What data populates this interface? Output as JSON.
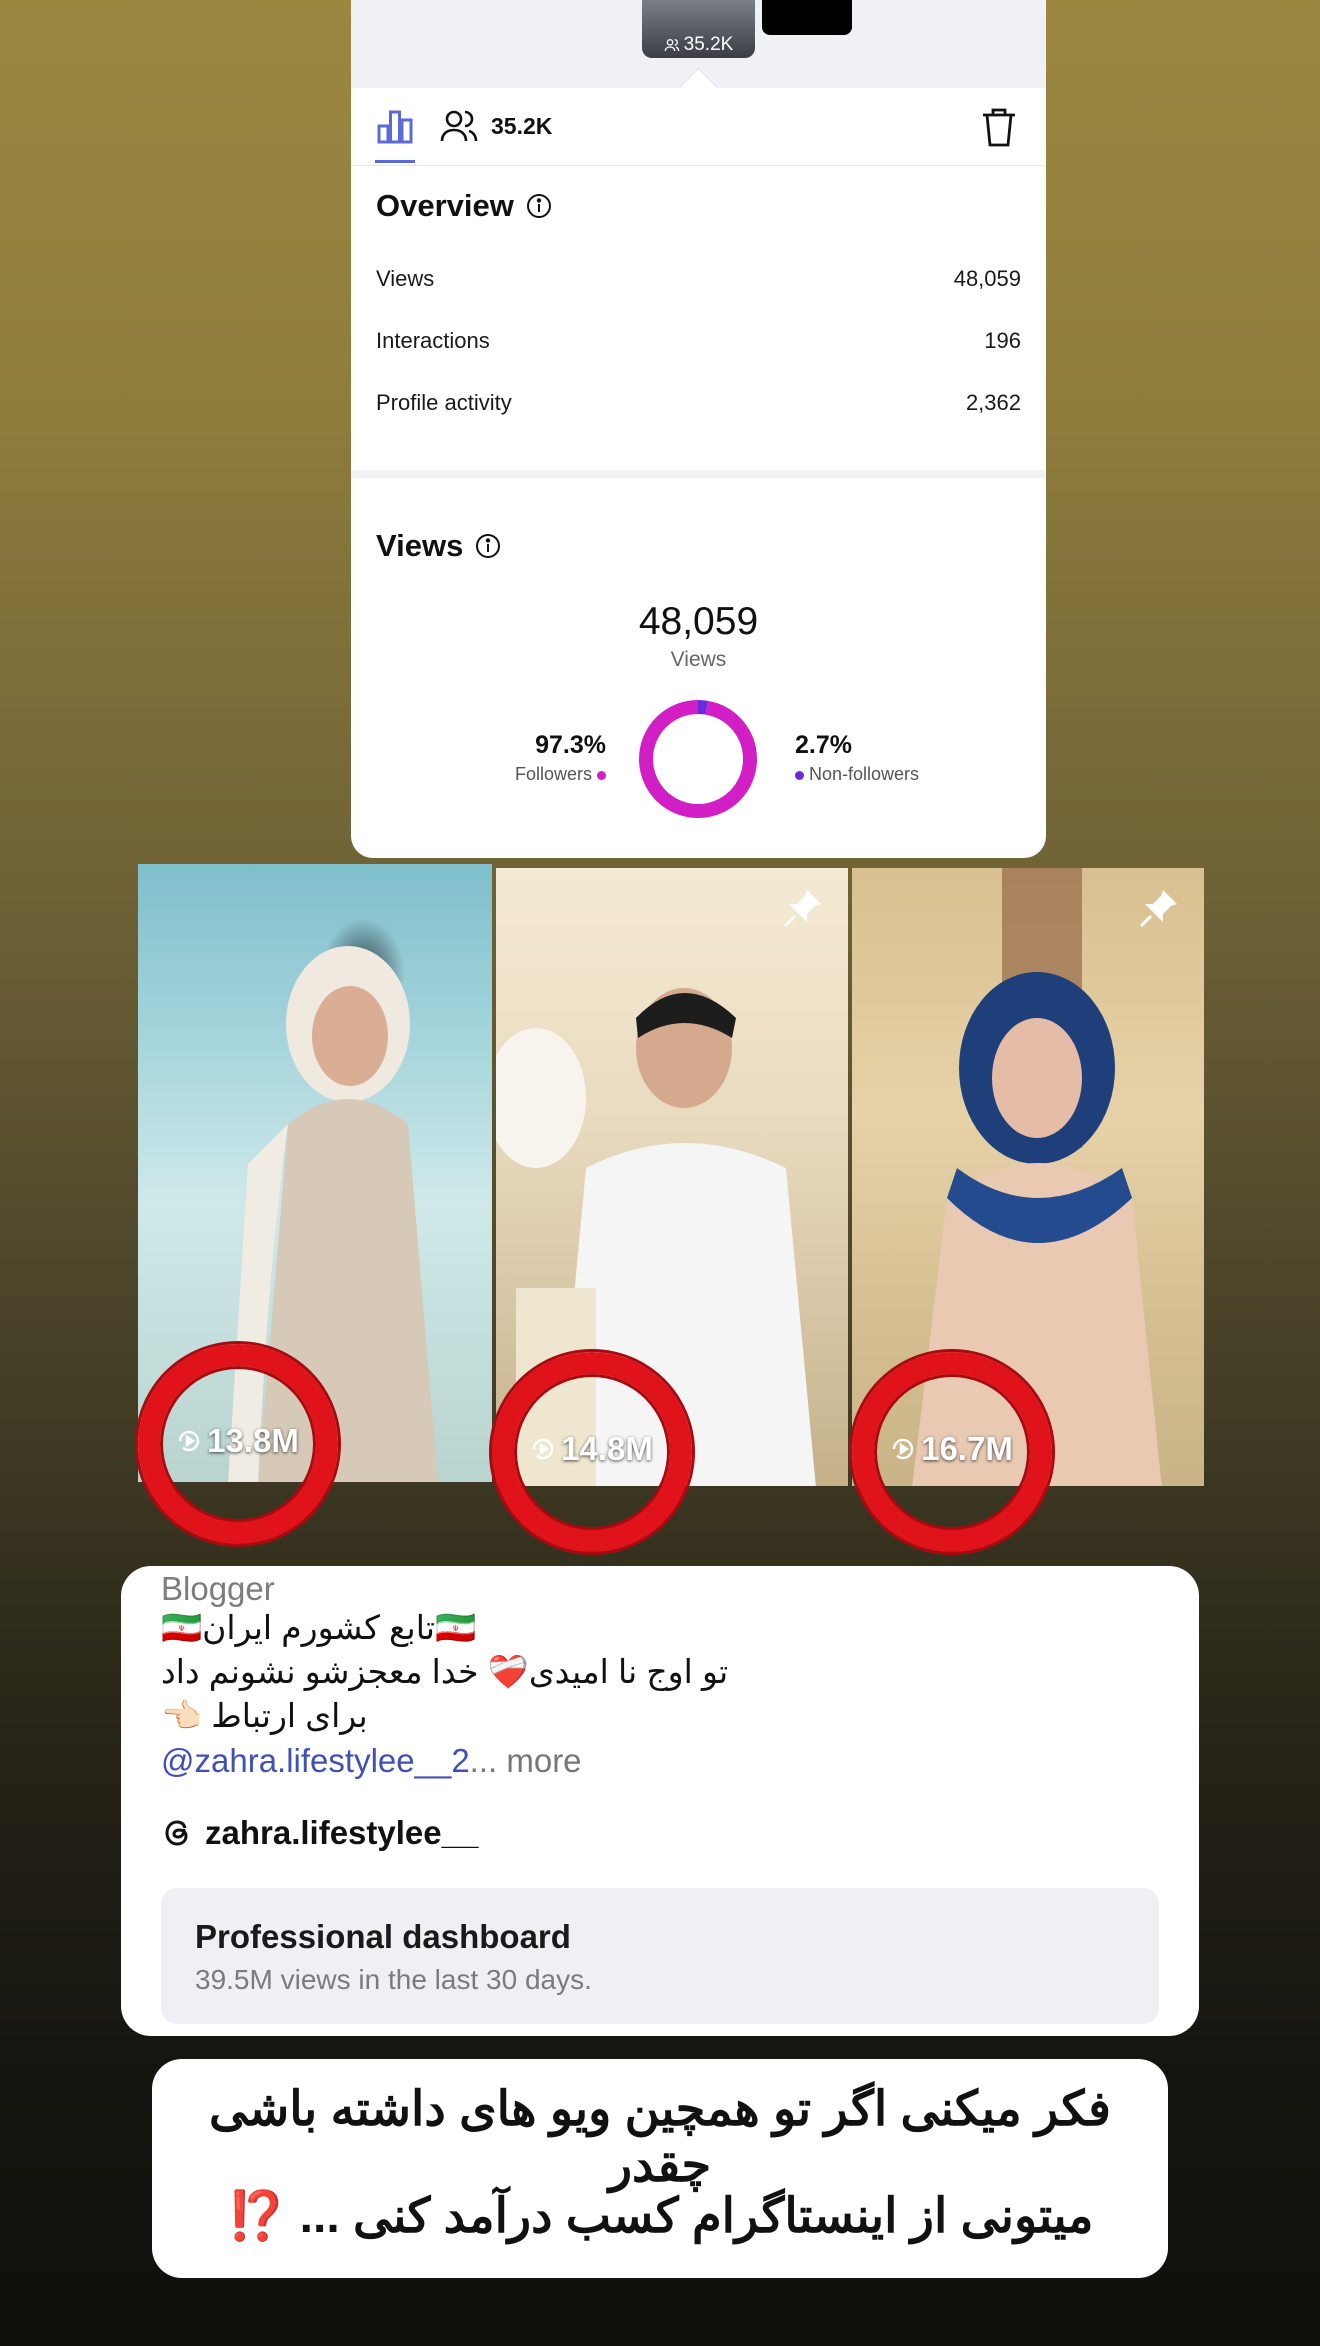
{
  "post_header": {
    "thumb_count": "35.2K",
    "tab_count": "35.2K"
  },
  "overview": {
    "title": "Overview",
    "rows": [
      {
        "label": "Views",
        "value": "48,059"
      },
      {
        "label": "Interactions",
        "value": "196"
      },
      {
        "label": "Profile activity",
        "value": "2,362"
      }
    ]
  },
  "views": {
    "title": "Views",
    "total": "48,059",
    "total_label": "Views",
    "followers_pct": "97.3%",
    "followers_label": "Followers",
    "nonfollowers_pct": "2.7%",
    "nonfollowers_label": "Non-followers",
    "followers_share": 0.973,
    "colors": {
      "followers": "#d21fc5",
      "nonfollowers": "#6a2be0"
    }
  },
  "reels": [
    {
      "views": "13.8M",
      "pinned": false
    },
    {
      "views": "14.8M",
      "pinned": true
    },
    {
      "views": "16.7M",
      "pinned": true
    }
  ],
  "bio": {
    "category": "Blogger",
    "line1": "🇮🇷تابع کشورم ایران🇮🇷",
    "line2": "تو اوج نا امیدی❤️‍🩹 خدا معجزشو نشونم داد",
    "line3": "برای ارتباط 👈🏻",
    "link_handle": "@zahra.lifestylee__2",
    "more": "... more",
    "threads_handle": "zahra.lifestylee__",
    "dashboard_title": "Professional dashboard",
    "dashboard_sub": "39.5M views in the last 30 days."
  },
  "caption": {
    "line1": "فکر میکنی اگر تو همچین ویو های داشته باشی چقدر",
    "line2": "میتونی از اینستاگرام کسب درآمد کنی ...",
    "emphasis": "⁉️"
  },
  "accent_colors": {
    "tab_active": "#5a6ad9",
    "ring": "#e0121a",
    "link": "#3f51b5"
  }
}
